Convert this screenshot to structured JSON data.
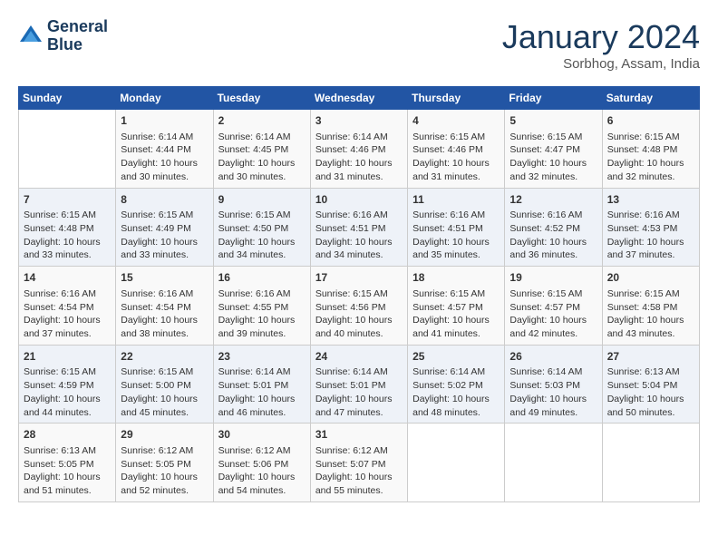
{
  "header": {
    "logo_line1": "General",
    "logo_line2": "Blue",
    "month": "January 2024",
    "location": "Sorbhog, Assam, India"
  },
  "weekdays": [
    "Sunday",
    "Monday",
    "Tuesday",
    "Wednesday",
    "Thursday",
    "Friday",
    "Saturday"
  ],
  "weeks": [
    [
      {
        "day": "",
        "info": ""
      },
      {
        "day": "1",
        "info": "Sunrise: 6:14 AM\nSunset: 4:44 PM\nDaylight: 10 hours\nand 30 minutes."
      },
      {
        "day": "2",
        "info": "Sunrise: 6:14 AM\nSunset: 4:45 PM\nDaylight: 10 hours\nand 30 minutes."
      },
      {
        "day": "3",
        "info": "Sunrise: 6:14 AM\nSunset: 4:46 PM\nDaylight: 10 hours\nand 31 minutes."
      },
      {
        "day": "4",
        "info": "Sunrise: 6:15 AM\nSunset: 4:46 PM\nDaylight: 10 hours\nand 31 minutes."
      },
      {
        "day": "5",
        "info": "Sunrise: 6:15 AM\nSunset: 4:47 PM\nDaylight: 10 hours\nand 32 minutes."
      },
      {
        "day": "6",
        "info": "Sunrise: 6:15 AM\nSunset: 4:48 PM\nDaylight: 10 hours\nand 32 minutes."
      }
    ],
    [
      {
        "day": "7",
        "info": "Sunrise: 6:15 AM\nSunset: 4:48 PM\nDaylight: 10 hours\nand 33 minutes."
      },
      {
        "day": "8",
        "info": "Sunrise: 6:15 AM\nSunset: 4:49 PM\nDaylight: 10 hours\nand 33 minutes."
      },
      {
        "day": "9",
        "info": "Sunrise: 6:15 AM\nSunset: 4:50 PM\nDaylight: 10 hours\nand 34 minutes."
      },
      {
        "day": "10",
        "info": "Sunrise: 6:16 AM\nSunset: 4:51 PM\nDaylight: 10 hours\nand 34 minutes."
      },
      {
        "day": "11",
        "info": "Sunrise: 6:16 AM\nSunset: 4:51 PM\nDaylight: 10 hours\nand 35 minutes."
      },
      {
        "day": "12",
        "info": "Sunrise: 6:16 AM\nSunset: 4:52 PM\nDaylight: 10 hours\nand 36 minutes."
      },
      {
        "day": "13",
        "info": "Sunrise: 6:16 AM\nSunset: 4:53 PM\nDaylight: 10 hours\nand 37 minutes."
      }
    ],
    [
      {
        "day": "14",
        "info": "Sunrise: 6:16 AM\nSunset: 4:54 PM\nDaylight: 10 hours\nand 37 minutes."
      },
      {
        "day": "15",
        "info": "Sunrise: 6:16 AM\nSunset: 4:54 PM\nDaylight: 10 hours\nand 38 minutes."
      },
      {
        "day": "16",
        "info": "Sunrise: 6:16 AM\nSunset: 4:55 PM\nDaylight: 10 hours\nand 39 minutes."
      },
      {
        "day": "17",
        "info": "Sunrise: 6:15 AM\nSunset: 4:56 PM\nDaylight: 10 hours\nand 40 minutes."
      },
      {
        "day": "18",
        "info": "Sunrise: 6:15 AM\nSunset: 4:57 PM\nDaylight: 10 hours\nand 41 minutes."
      },
      {
        "day": "19",
        "info": "Sunrise: 6:15 AM\nSunset: 4:57 PM\nDaylight: 10 hours\nand 42 minutes."
      },
      {
        "day": "20",
        "info": "Sunrise: 6:15 AM\nSunset: 4:58 PM\nDaylight: 10 hours\nand 43 minutes."
      }
    ],
    [
      {
        "day": "21",
        "info": "Sunrise: 6:15 AM\nSunset: 4:59 PM\nDaylight: 10 hours\nand 44 minutes."
      },
      {
        "day": "22",
        "info": "Sunrise: 6:15 AM\nSunset: 5:00 PM\nDaylight: 10 hours\nand 45 minutes."
      },
      {
        "day": "23",
        "info": "Sunrise: 6:14 AM\nSunset: 5:01 PM\nDaylight: 10 hours\nand 46 minutes."
      },
      {
        "day": "24",
        "info": "Sunrise: 6:14 AM\nSunset: 5:01 PM\nDaylight: 10 hours\nand 47 minutes."
      },
      {
        "day": "25",
        "info": "Sunrise: 6:14 AM\nSunset: 5:02 PM\nDaylight: 10 hours\nand 48 minutes."
      },
      {
        "day": "26",
        "info": "Sunrise: 6:14 AM\nSunset: 5:03 PM\nDaylight: 10 hours\nand 49 minutes."
      },
      {
        "day": "27",
        "info": "Sunrise: 6:13 AM\nSunset: 5:04 PM\nDaylight: 10 hours\nand 50 minutes."
      }
    ],
    [
      {
        "day": "28",
        "info": "Sunrise: 6:13 AM\nSunset: 5:05 PM\nDaylight: 10 hours\nand 51 minutes."
      },
      {
        "day": "29",
        "info": "Sunrise: 6:12 AM\nSunset: 5:05 PM\nDaylight: 10 hours\nand 52 minutes."
      },
      {
        "day": "30",
        "info": "Sunrise: 6:12 AM\nSunset: 5:06 PM\nDaylight: 10 hours\nand 54 minutes."
      },
      {
        "day": "31",
        "info": "Sunrise: 6:12 AM\nSunset: 5:07 PM\nDaylight: 10 hours\nand 55 minutes."
      },
      {
        "day": "",
        "info": ""
      },
      {
        "day": "",
        "info": ""
      },
      {
        "day": "",
        "info": ""
      }
    ]
  ]
}
